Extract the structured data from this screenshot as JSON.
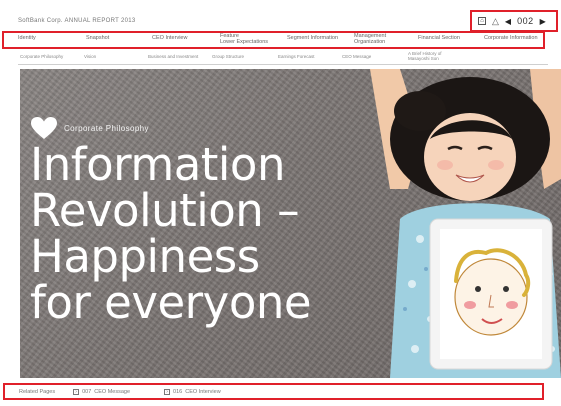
{
  "header": {
    "brand": "SoftBank Corp.  ANNUAL REPORT 2013",
    "page_number": "002"
  },
  "main_nav": {
    "items": [
      {
        "label": "Identity"
      },
      {
        "label": "Snapshot"
      },
      {
        "label": "CEO Interview"
      },
      {
        "label": "Feature\nLower Expectations"
      },
      {
        "label": "Segment Information"
      },
      {
        "label": "Management\nOrganization"
      },
      {
        "label": "Financial Section"
      },
      {
        "label": "Corporate Information"
      }
    ]
  },
  "sub_nav": {
    "items": [
      {
        "label": "Corporate Philosophy"
      },
      {
        "label": "Vision"
      },
      {
        "label": "Business and Investment"
      },
      {
        "label": "Group Structure"
      },
      {
        "label": "Earnings Forecast"
      },
      {
        "label": "CEO Message"
      },
      {
        "label": "A Brief History of\nMasayoshi Son"
      }
    ]
  },
  "hero": {
    "tagline": "Corporate Philosophy",
    "headline_lines": [
      "Information",
      "Revolution –",
      "Happiness",
      "for everyone"
    ]
  },
  "footer": {
    "title": "Related Pages",
    "links": [
      {
        "page": "007",
        "label": "CEO Message"
      },
      {
        "page": "016",
        "label": "CEO Interview"
      }
    ]
  },
  "colors": {
    "highlight": "#e0202a"
  },
  "icons": [
    "home-icon",
    "alert-triangle-icon",
    "previous-page-icon",
    "next-page-icon",
    "heart-icon",
    "link-arrow-icon"
  ]
}
